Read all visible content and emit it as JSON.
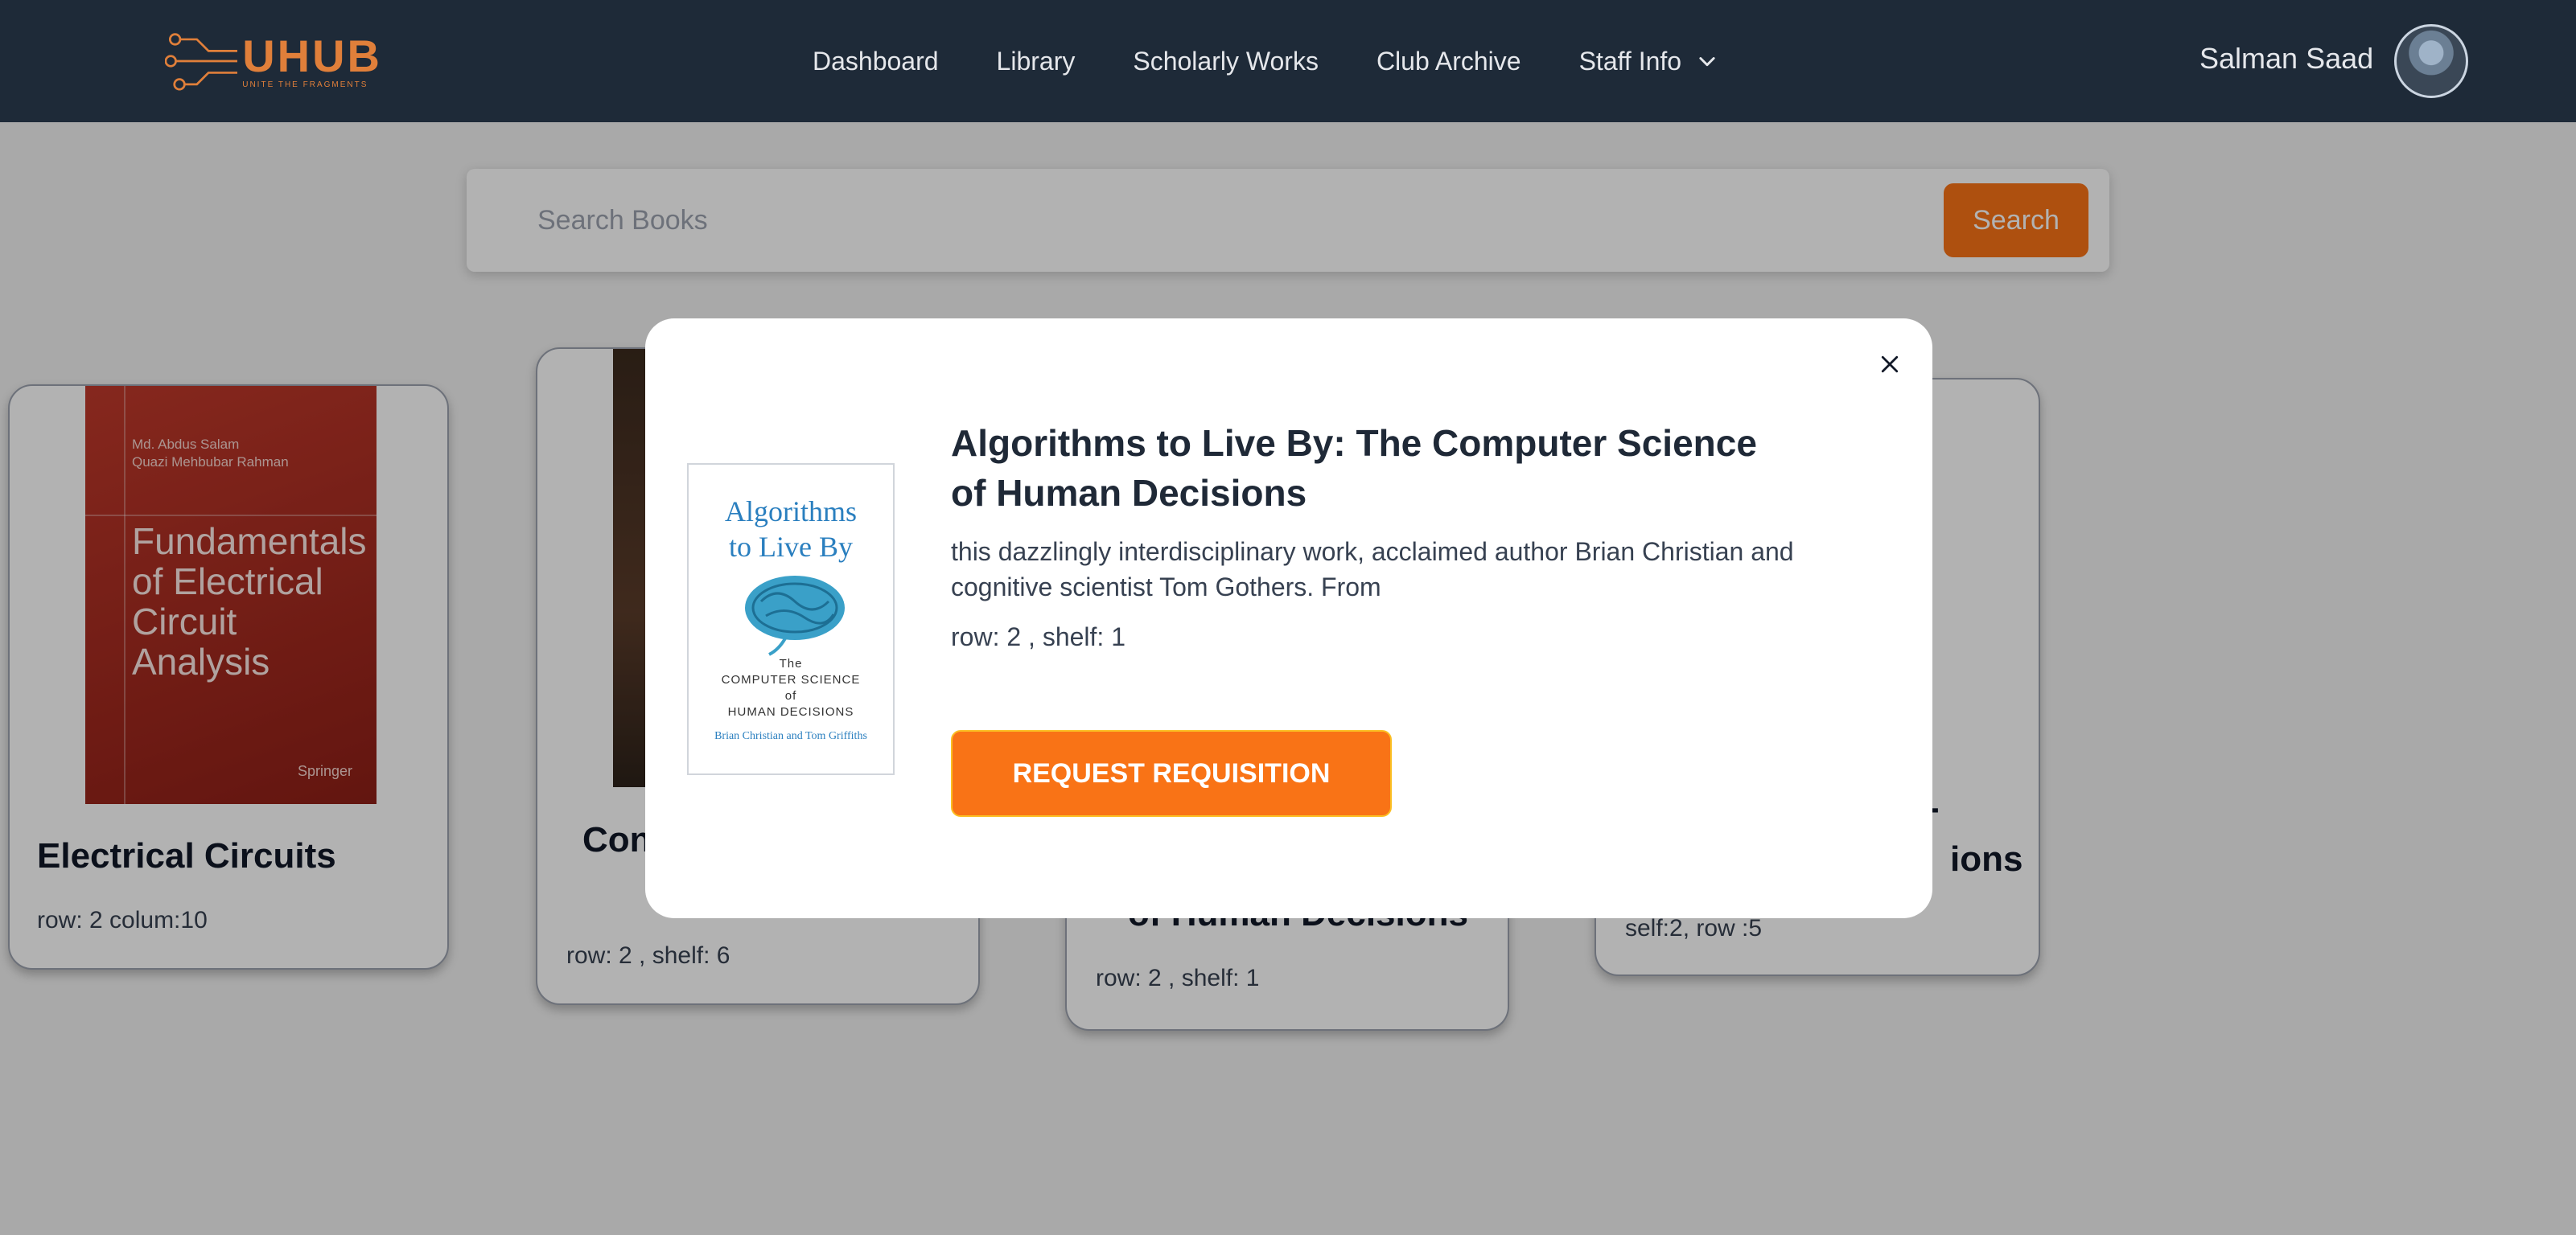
{
  "nav": {
    "logo_title": "UHUB",
    "logo_tagline": "UNITE THE FRAGMENTS",
    "links": [
      "Dashboard",
      "Library",
      "Scholarly Works",
      "Club Archive",
      "Staff Info"
    ],
    "user_name": "Salman Saad"
  },
  "search": {
    "placeholder": "Search Books",
    "button_label": "Search"
  },
  "cards": [
    {
      "title": "Electrical Circuits",
      "meta": "row: 2 colum:10",
      "cover": {
        "authors": [
          "Md. Abdus Salam",
          "Quazi Mehbubar Rahman"
        ],
        "title_lines": [
          "Fundamentals",
          "of Electrical",
          "Circuit Analysis"
        ],
        "publisher": "Springer"
      }
    },
    {
      "title": "Con",
      "meta": "row: 2 , shelf: 6"
    },
    {
      "title": "of Human Decisions",
      "meta": "row: 2 , shelf: 1"
    },
    {
      "title_line1": "-",
      "title_line2": "ions",
      "meta": "self:2, row :5"
    }
  ],
  "modal": {
    "title": "Algorithms to Live By: The Computer Science of Human Decisions",
    "description": "this dazzlingly interdisciplinary work, acclaimed author Brian Christian and cognitive scientist Tom Gothers. From",
    "meta": "row: 2 , shelf: 1",
    "button_label": "REQUEST REQUISITION",
    "cover": {
      "title_lines": [
        "Algorithms",
        "to Live By"
      ],
      "subtitle_lines": [
        "The",
        "COMPUTER SCIENCE",
        "of",
        "HUMAN DECISIONS"
      ],
      "authors": "Brian Christian and Tom Griffiths"
    }
  },
  "colors": {
    "navbar": "#1e2a38",
    "accent": "#f97316",
    "logo": "#e07f3a"
  }
}
